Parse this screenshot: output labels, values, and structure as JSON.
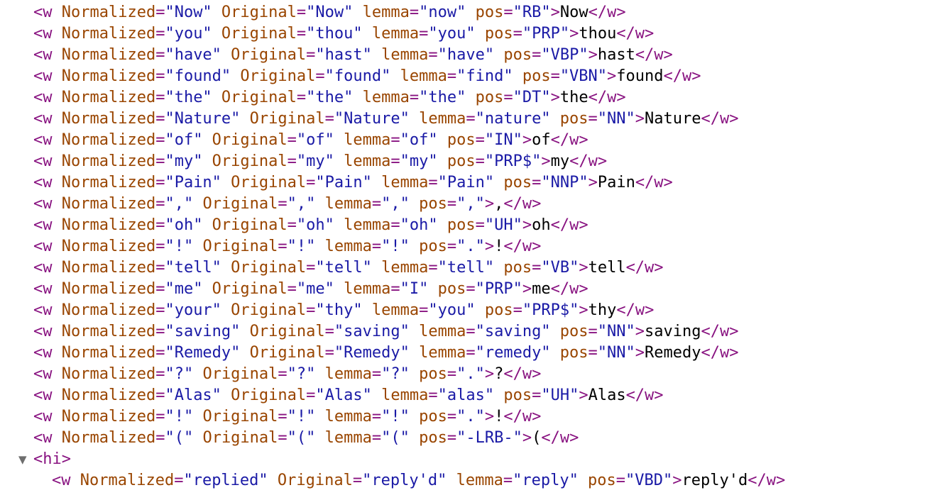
{
  "rows": [
    {
      "n": "Now",
      "o": "Now",
      "l": "now",
      "p": "RB",
      "t": "Now"
    },
    {
      "n": "you",
      "o": "thou",
      "l": "you",
      "p": "PRP",
      "t": "thou"
    },
    {
      "n": "have",
      "o": "hast",
      "l": "have",
      "p": "VBP",
      "t": "hast"
    },
    {
      "n": "found",
      "o": "found",
      "l": "find",
      "p": "VBN",
      "t": "found"
    },
    {
      "n": "the",
      "o": "the",
      "l": "the",
      "p": "DT",
      "t": "the"
    },
    {
      "n": "Nature",
      "o": "Nature",
      "l": "nature",
      "p": "NN",
      "t": "Nature"
    },
    {
      "n": "of",
      "o": "of",
      "l": "of",
      "p": "IN",
      "t": "of"
    },
    {
      "n": "my",
      "o": "my",
      "l": "my",
      "p": "PRP$",
      "t": "my"
    },
    {
      "n": "Pain",
      "o": "Pain",
      "l": "Pain",
      "p": "NNP",
      "t": "Pain"
    },
    {
      "n": ",",
      "o": ",",
      "l": ",",
      "p": ",",
      "t": ","
    },
    {
      "n": "oh",
      "o": "oh",
      "l": "oh",
      "p": "UH",
      "t": "oh"
    },
    {
      "n": "!",
      "o": "!",
      "l": "!",
      "p": ".",
      "t": "!"
    },
    {
      "n": "tell",
      "o": "tell",
      "l": "tell",
      "p": "VB",
      "t": "tell"
    },
    {
      "n": "me",
      "o": "me",
      "l": "I",
      "p": "PRP",
      "t": "me"
    },
    {
      "n": "your",
      "o": "thy",
      "l": "you",
      "p": "PRP$",
      "t": "thy"
    },
    {
      "n": "saving",
      "o": "saving",
      "l": "saving",
      "p": "NN",
      "t": "saving"
    },
    {
      "n": "Remedy",
      "o": "Remedy",
      "l": "remedy",
      "p": "NN",
      "t": "Remedy"
    },
    {
      "n": "?",
      "o": "?",
      "l": "?",
      "p": ".",
      "t": "?"
    },
    {
      "n": "Alas",
      "o": "Alas",
      "l": "alas",
      "p": "UH",
      "t": "Alas"
    },
    {
      "n": "!",
      "o": "!",
      "l": "!",
      "p": ".",
      "t": "!"
    },
    {
      "n": "(",
      "o": "(",
      "l": "(",
      "p": "-LRB-",
      "t": "("
    }
  ],
  "hi_node": {
    "tag": "<hi>",
    "toggle_glyph": "▼",
    "child": {
      "n": "replied",
      "o": "reply'd",
      "l": "reply",
      "p": "VBD",
      "t": "reply'd"
    }
  },
  "colors": {
    "tag": "#881280",
    "attribute": "#994500",
    "value": "#1a1aa6",
    "text": "#000000"
  },
  "icons": {
    "toggle": "disclosure-triangle-icon"
  }
}
